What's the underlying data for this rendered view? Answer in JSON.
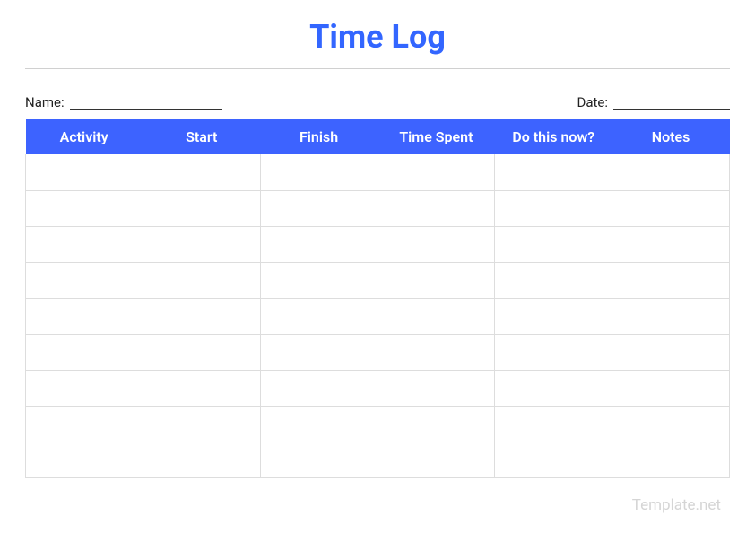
{
  "title": "Time Log",
  "fields": {
    "name_label": "Name:",
    "date_label": "Date:"
  },
  "table": {
    "headers": [
      "Activity",
      "Start",
      "Finish",
      "Time Spent",
      "Do this now?",
      "Notes"
    ],
    "row_count": 9
  },
  "watermark": "Template.net"
}
